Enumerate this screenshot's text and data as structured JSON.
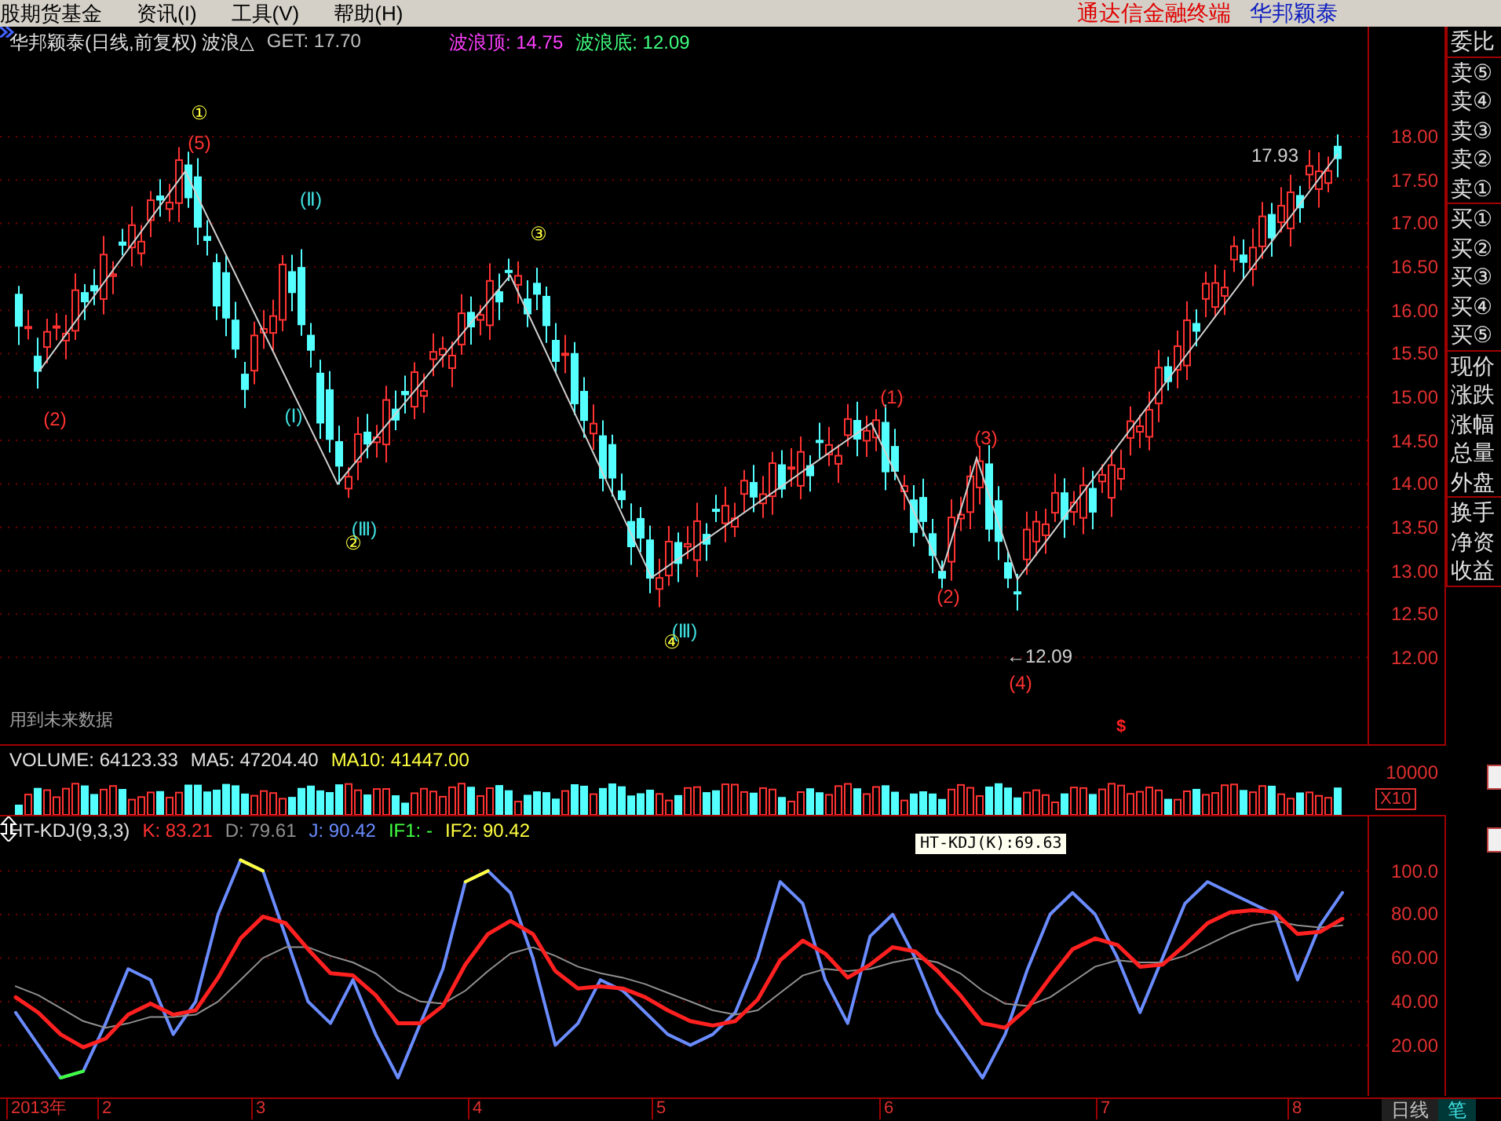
{
  "menu": {
    "items": [
      {
        "label": "股期货基金"
      },
      {
        "label": "资讯(I)"
      },
      {
        "label": "工具(V)"
      },
      {
        "label": "帮助(H)"
      }
    ],
    "app_title": "通达信金融终端",
    "stock_name": "华邦颖泰"
  },
  "price_pane": {
    "header": [
      {
        "text": "华邦颖泰(日线,前复权) 波浪△",
        "color": "#e0e0e0"
      },
      {
        "text": "GET: 17.70",
        "color": "#c0c0c0"
      },
      {
        "text": "波浪顶: 14.75",
        "color": "#ff40ff"
      },
      {
        "text": "波浪底: 12.09",
        "color": "#40ff80"
      }
    ],
    "wave_labels": [
      {
        "text": "①",
        "color": "#ffff40"
      },
      {
        "text": "(5)",
        "color": "#ff3232"
      },
      {
        "text": "(Ⅱ)",
        "color": "#40e0e0"
      },
      {
        "text": "③",
        "color": "#ffff40"
      },
      {
        "text": "(2)",
        "color": "#ff3232"
      },
      {
        "text": "(Ⅰ)",
        "color": "#40e0e0"
      },
      {
        "text": "(Ⅲ)",
        "color": "#40e0e0"
      },
      {
        "text": "②",
        "color": "#ffff40"
      },
      {
        "text": "(Ⅲ)",
        "color": "#40e0e0"
      },
      {
        "text": "④",
        "color": "#ffff40"
      },
      {
        "text": "(1)",
        "color": "#ff3232"
      },
      {
        "text": "(3)",
        "color": "#ff3232"
      },
      {
        "text": "(2)",
        "color": "#ff3232"
      },
      {
        "text": "(4)",
        "color": "#ff3232"
      },
      {
        "text": "17.93",
        "color": "#d0d0d0"
      },
      {
        "text": "←12.09",
        "color": "#d0d0d0"
      }
    ],
    "note": "用到未来数据",
    "marker": "$",
    "axis_labels": [
      "18.00",
      "17.50",
      "17.00",
      "16.50",
      "16.00",
      "15.50",
      "15.00",
      "14.50",
      "14.00",
      "13.50",
      "13.00",
      "12.50",
      "12.00"
    ]
  },
  "volume_pane": {
    "header": [
      {
        "text": "VOLUME: 64123.33",
        "color": "#e0e0e0"
      },
      {
        "text": "MA5: 47204.40",
        "color": "#e0e0e0"
      },
      {
        "text": "MA10: 41447.00",
        "color": "#ffff40"
      }
    ],
    "axis_label": "10000",
    "scale": "X10"
  },
  "kdj_pane": {
    "header": [
      {
        "text": "HT-KDJ(9,3,3)",
        "color": "#e0e0e0"
      },
      {
        "text": "K: 83.21",
        "color": "#ff3232"
      },
      {
        "text": "D: 79.61",
        "color": "#909090"
      },
      {
        "text": "J: 90.42",
        "color": "#6a8cff"
      },
      {
        "text": "IF1: -",
        "color": "#40ff40"
      },
      {
        "text": "IF2: 90.42",
        "color": "#ffff40"
      }
    ],
    "tooltip": "HT-KDJ(K):69.63",
    "chart_data": {
      "type": "line",
      "grid": true,
      "ylim": [
        -4,
        125
      ],
      "yticks": [
        {
          "value": 100,
          "label": "100.0"
        },
        {
          "value": 80,
          "label": "80.00"
        },
        {
          "value": 60,
          "label": "60.00"
        },
        {
          "value": 40,
          "label": "40.00"
        },
        {
          "value": 20,
          "label": "20.00"
        }
      ],
      "series": [
        {
          "color": "#6a8cff",
          "values": [
            35,
            20,
            5,
            8,
            30,
            55,
            50,
            25,
            40,
            80,
            105,
            100,
            70,
            40,
            30,
            50,
            25,
            5,
            30,
            55,
            95,
            100,
            90,
            60,
            20,
            30,
            50,
            45,
            35,
            25,
            20,
            25,
            35,
            60,
            95,
            85,
            50,
            30,
            70,
            80,
            60,
            35,
            20,
            5,
            25,
            55,
            80,
            90,
            80,
            60,
            35,
            60,
            85,
            95,
            90,
            85,
            80,
            50,
            75,
            90
          ]
        },
        {
          "color": "#909090",
          "values": [
            47,
            43,
            37,
            31,
            28,
            30,
            33,
            33,
            34,
            40,
            50,
            60,
            65,
            65,
            61,
            58,
            53,
            45,
            40,
            39,
            45,
            54,
            62,
            65,
            61,
            56,
            53,
            51,
            48,
            44,
            40,
            36,
            34,
            36,
            44,
            52,
            55,
            54,
            55,
            58,
            60,
            58,
            53,
            45,
            39,
            38,
            42,
            49,
            56,
            59,
            58,
            58,
            61,
            66,
            71,
            75,
            77,
            75,
            74,
            75
          ]
        },
        {
          "color": "#ff2020",
          "values": [
            42,
            35,
            25,
            19,
            23,
            34,
            39,
            34,
            36,
            51,
            69,
            79,
            76,
            64,
            53,
            52,
            43,
            30,
            30,
            38,
            57,
            71,
            77,
            71,
            54,
            46,
            47,
            46,
            42,
            36,
            31,
            29,
            31,
            41,
            59,
            68,
            62,
            51,
            57,
            65,
            63,
            54,
            43,
            30,
            28,
            37,
            51,
            64,
            69,
            66,
            56,
            57,
            66,
            76,
            81,
            82,
            81,
            71,
            72,
            78
          ]
        },
        {
          "color": "#ffff40",
          "values": [
            null,
            null,
            null,
            null,
            null,
            null,
            null,
            null,
            null,
            null,
            105,
            100,
            null,
            null,
            null,
            null,
            null,
            null,
            null,
            null,
            95,
            100,
            null,
            null,
            null,
            null,
            null,
            null,
            null,
            null,
            null,
            null,
            null,
            null,
            null,
            null,
            null,
            null,
            null,
            null,
            null,
            null,
            null,
            null,
            null,
            null,
            null,
            null,
            null,
            null,
            null,
            null,
            null,
            null,
            null,
            null,
            null,
            null,
            null,
            null
          ]
        },
        {
          "color": "#40ff40",
          "values": [
            null,
            null,
            5,
            8,
            null,
            null,
            null,
            null,
            null,
            null,
            null,
            null,
            null,
            null,
            null,
            null,
            null,
            null,
            null,
            null,
            null,
            null,
            null,
            null,
            null,
            null,
            null,
            null,
            null,
            null,
            null,
            null,
            null,
            null,
            null,
            null,
            null,
            null,
            null,
            null,
            null,
            null,
            null,
            null,
            null,
            null,
            null,
            null,
            null,
            null,
            null,
            null,
            null,
            null,
            null,
            null,
            null,
            null,
            null,
            null
          ]
        }
      ]
    }
  },
  "time_axis": [
    "2013年",
    "2",
    "3",
    "4",
    "5",
    "6",
    "7",
    "8"
  ],
  "side_panel": {
    "groups": [
      {
        "items": [
          "委比"
        ]
      },
      {
        "items": [
          "卖⑤",
          "卖④",
          "卖③",
          "卖②",
          "卖①"
        ]
      },
      {
        "items": [
          "买①",
          "买②",
          "买③",
          "买④",
          "买⑤"
        ]
      },
      {
        "items": [
          "现价",
          "涨跌",
          "涨幅",
          "总量",
          "外盘"
        ]
      },
      {
        "items": [
          "换手",
          "净资",
          "收益"
        ]
      }
    ]
  },
  "bottom_tabs": [
    {
      "label": "日线",
      "selected": false
    },
    {
      "label": "笔",
      "selected": true
    }
  ]
}
